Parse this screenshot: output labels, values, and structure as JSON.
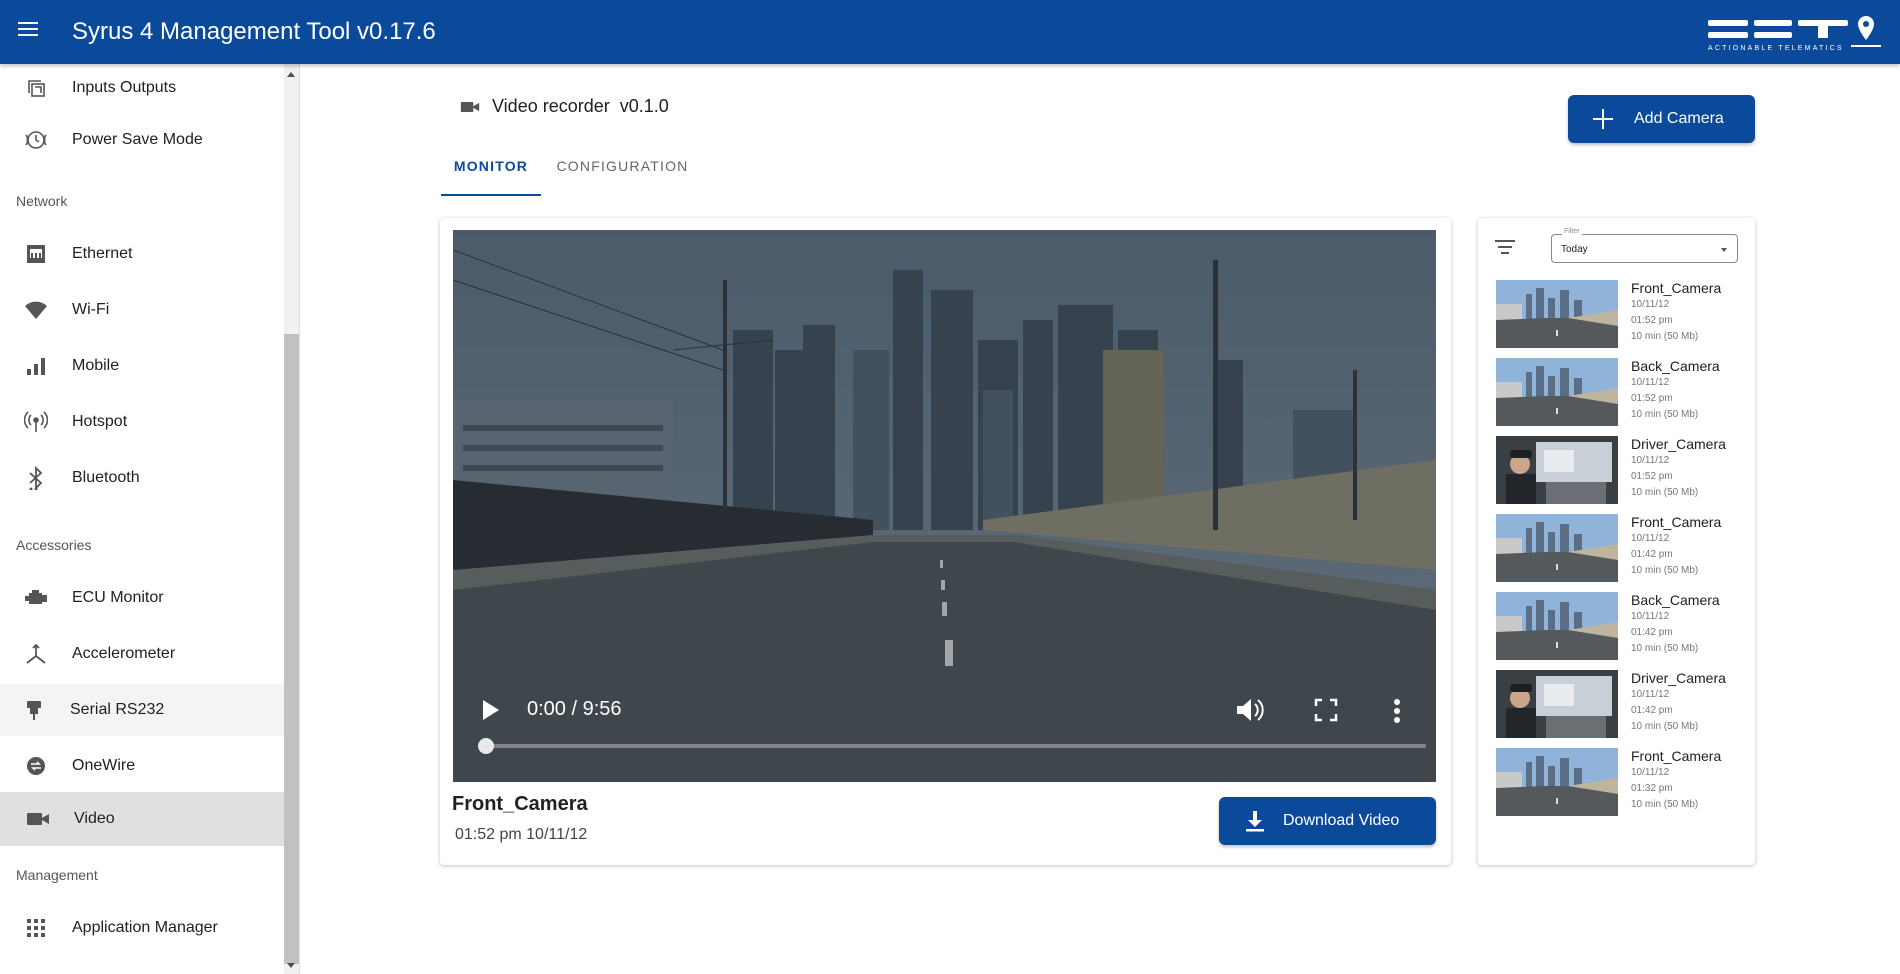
{
  "app": {
    "title": "Syrus 4 Management Tool v0.17.6",
    "brand_color": "#0b4a9b",
    "logo_text": "ACTIONABLE TELEMATICS"
  },
  "sidebar": {
    "items": [
      {
        "label": "Inputs Outputs",
        "icon": "inputs-outputs-icon"
      },
      {
        "label": "Power Save Mode",
        "icon": "power-save-icon"
      },
      {
        "label": "Ethernet",
        "icon": "ethernet-icon"
      },
      {
        "label": "Wi-Fi",
        "icon": "wifi-icon"
      },
      {
        "label": "Mobile",
        "icon": "signal-bars-icon"
      },
      {
        "label": "Hotspot",
        "icon": "hotspot-icon"
      },
      {
        "label": "Bluetooth",
        "icon": "bluetooth-icon"
      },
      {
        "label": "ECU Monitor",
        "icon": "engine-icon"
      },
      {
        "label": "Accelerometer",
        "icon": "axis-icon"
      },
      {
        "label": "Serial RS232",
        "icon": "serial-plug-icon"
      },
      {
        "label": "OneWire",
        "icon": "onewire-icon"
      },
      {
        "label": "Video",
        "icon": "videocam-icon"
      },
      {
        "label": "Application Manager",
        "icon": "apps-grid-icon"
      }
    ],
    "sections": [
      "Network",
      "Accessories",
      "Management"
    ]
  },
  "page": {
    "title": "Video recorder  v0.1.0",
    "add_camera_label": "Add Camera",
    "tabs": [
      {
        "label": "MONITOR",
        "active": true
      },
      {
        "label": "CONFIGURATION",
        "active": false
      }
    ]
  },
  "player": {
    "time": "0:00 / 9:56",
    "progress": 0.0,
    "camera_name": "Front_Camera",
    "date": "01:52 pm 10/11/12",
    "download_label": "Download Video"
  },
  "filter": {
    "label": "Filter",
    "value": "Today"
  },
  "recordings": [
    {
      "name": "Front_Camera",
      "date": "10/11/12",
      "time": "01:52 pm",
      "info": "10 min (50 Mb)",
      "thumb": "street"
    },
    {
      "name": "Back_Camera",
      "date": "10/11/12",
      "time": "01:52 pm",
      "info": "10 min (50 Mb)",
      "thumb": "street"
    },
    {
      "name": "Driver_Camera",
      "date": "10/11/12",
      "time": "01:52 pm",
      "info": "10 min (50 Mb)",
      "thumb": "driver"
    },
    {
      "name": "Front_Camera",
      "date": "10/11/12",
      "time": "01:42 pm",
      "info": "10 min (50 Mb)",
      "thumb": "street"
    },
    {
      "name": "Back_Camera",
      "date": "10/11/12",
      "time": "01:42 pm",
      "info": "10 min (50 Mb)",
      "thumb": "street"
    },
    {
      "name": "Driver_Camera",
      "date": "10/11/12",
      "time": "01:42 pm",
      "info": "10 min (50 Mb)",
      "thumb": "driver"
    },
    {
      "name": "Front_Camera",
      "date": "10/11/12",
      "time": "01:32 pm",
      "info": "10 min (50 Mb)",
      "thumb": "street"
    }
  ]
}
